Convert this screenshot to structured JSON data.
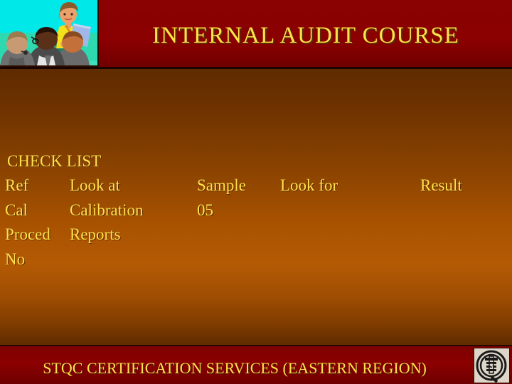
{
  "slide": {
    "title": "INTERNAL AUDIT COURSE",
    "colors": {
      "header_red": "#8B0000",
      "body_orange": "#B45A05",
      "body_brown": "#5E2B00",
      "text_yellow": "#FFE14D",
      "clipart_bg": "#00E0E0"
    }
  },
  "clipart": {
    "name": "training-classroom-illustration",
    "alt": "Woman presenting documents to a seated audience"
  },
  "content": {
    "checklist_heading": "CHECK LIST",
    "columns": [
      "Ref",
      "Look at",
      "Sample",
      "Look for",
      "Result"
    ],
    "rows": [
      {
        "ref": "Ref",
        "look_at": "Look at",
        "sample": "Sample",
        "look_for": "Look for",
        "result": "Result"
      },
      {
        "ref": "Cal",
        "look_at": "Calibration",
        "sample": "05",
        "look_for": "",
        "result": ""
      },
      {
        "ref": "Proced",
        "look_at": "Reports",
        "sample": "",
        "look_for": "",
        "result": ""
      },
      {
        "ref": "No",
        "look_at": "",
        "sample": "",
        "look_for": "",
        "result": ""
      }
    ]
  },
  "footer": {
    "text": "STQC CERTIFICATION SERVICES (EASTERN REGION)",
    "logo_label": "STQC"
  }
}
